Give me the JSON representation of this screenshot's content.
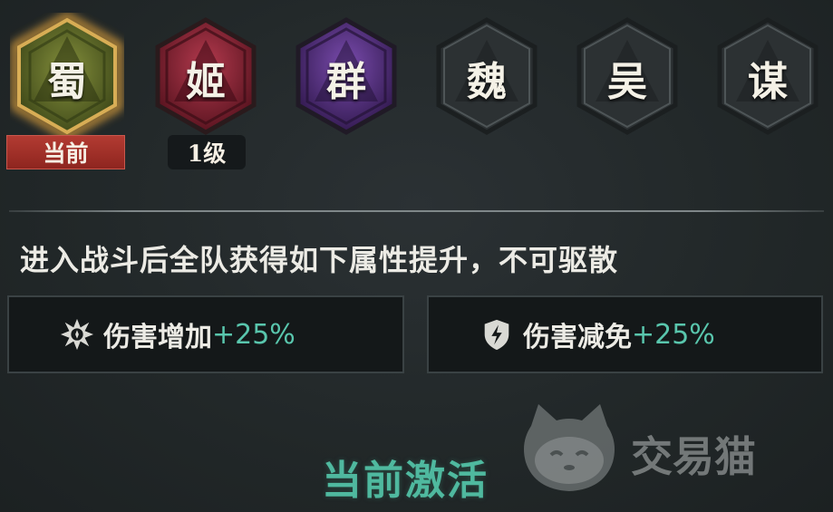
{
  "factions": [
    {
      "label": "蜀",
      "state": "current",
      "colors": {
        "fill": "#5c6a2c",
        "rim": "#c89a3e",
        "glow": "#e0a23c"
      }
    },
    {
      "label": "姬",
      "state": "unlocked",
      "colors": {
        "fill": "#8b2434",
        "rim": "#c5485a",
        "glow": ""
      }
    },
    {
      "label": "群",
      "state": "unlocked",
      "colors": {
        "fill": "#4d2c73",
        "rim": "#8a5fc0",
        "glow": ""
      }
    },
    {
      "label": "魏",
      "state": "locked",
      "colors": {
        "fill": "#2e3335",
        "rim": "#5b6264",
        "glow": ""
      }
    },
    {
      "label": "吴",
      "state": "locked",
      "colors": {
        "fill": "#2e3335",
        "rim": "#5b6264",
        "glow": ""
      }
    },
    {
      "label": "谋",
      "state": "locked",
      "colors": {
        "fill": "#2e3335",
        "rim": "#5b6264",
        "glow": ""
      }
    }
  ],
  "badges": {
    "current": "当前",
    "level": "1级"
  },
  "description": "进入战斗后全队获得如下属性提升，不可驱散",
  "stats": [
    {
      "icon": "burst-icon",
      "name": "伤害增加",
      "value": "+25%"
    },
    {
      "icon": "shield-bolt-icon",
      "name": "伤害减免",
      "value": "+25%"
    }
  ],
  "active_label": "当前激活",
  "watermark": {
    "text": "交易猫",
    "icon": "cat-icon"
  },
  "colors": {
    "accent": "#4fb99f",
    "value": "#59c6ad",
    "current_badge": "#a8312a"
  }
}
